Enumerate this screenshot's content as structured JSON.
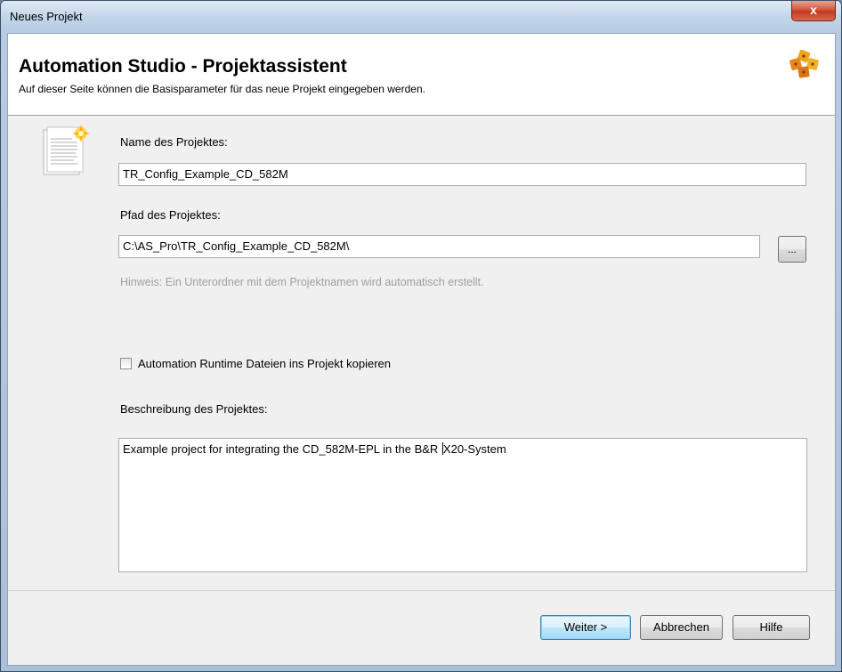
{
  "window": {
    "title": "Neues Projekt",
    "close_label": "x"
  },
  "header": {
    "title": "Automation Studio - Projektassistent",
    "subtitle": "Auf dieser Seite können die Basisparameter für das neue Projekt eingegeben werden."
  },
  "form": {
    "name_label": "Name des Projektes:",
    "name_value": "TR_Config_Example_CD_582M",
    "path_label": "Pfad des Projektes:",
    "path_value": "C:\\AS_Pro\\TR_Config_Example_CD_582M\\",
    "browse_label": "...",
    "hint": "Hinweis: Ein Unterordner mit dem Projektnamen wird automatisch erstellt.",
    "checkbox_label": "Automation Runtime Dateien ins Projekt kopieren",
    "checkbox_checked": false,
    "description_label": "Beschreibung des Projektes:",
    "description_before_caret": "Example project for integrating the CD_582M-EPL in the B&R ",
    "description_after_caret": "X20-System"
  },
  "buttons": {
    "next": "Weiter >",
    "cancel": "Abbrechen",
    "help": "Hilfe"
  },
  "icons": {
    "logo": "automation-studio-logo-icon",
    "document": "new-document-icon"
  }
}
